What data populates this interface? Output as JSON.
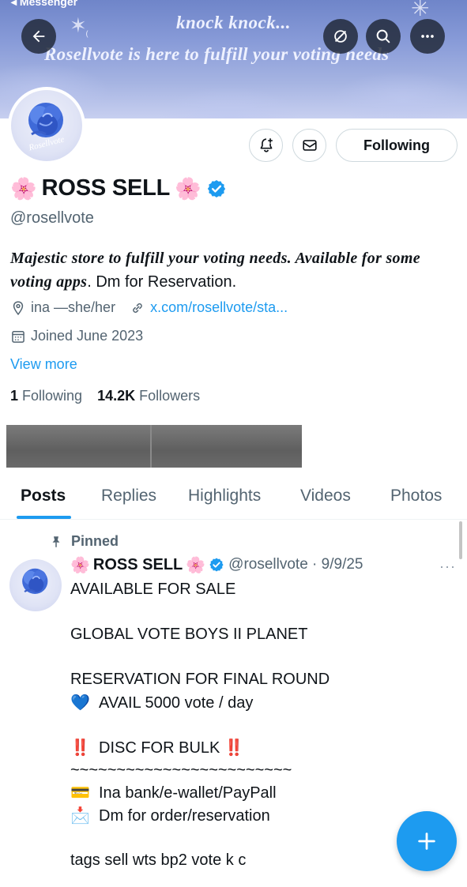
{
  "status": {
    "back_label": "◂ Messenger"
  },
  "banner": {
    "line1": "knock knock...",
    "line2": "Rosellvote is here to fulfill your voting needs"
  },
  "header_icons": {
    "back": "arrow-left-icon",
    "grok": "grok-icon",
    "search": "search-icon",
    "more": "more-horizontal-icon"
  },
  "avatar": {
    "text": "Rosellvote"
  },
  "actions": {
    "notify_icon": "bell-plus-icon",
    "message_icon": "envelope-icon",
    "following_label": "Following"
  },
  "profile": {
    "name_prefix_emoji": "🌸",
    "name": "ROSS SELL",
    "name_suffix_emoji": "🌸",
    "handle": "@rosellvote",
    "bio_fancy": "Majestic store to fulfill your voting needs. Available for some voting apps",
    "bio_plain": ". Dm for Reservation.",
    "location": "ina —she/her",
    "link": "x.com/rosellvote/sta...",
    "joined": "Joined June 2023",
    "view_more": "View more",
    "following_count": "1",
    "following_label": "Following",
    "followers_count": "14.2K",
    "followers_label": "Followers"
  },
  "tabs": [
    {
      "label": "Posts",
      "active": true
    },
    {
      "label": "Replies",
      "active": false
    },
    {
      "label": "Highlights",
      "active": false
    },
    {
      "label": "Videos",
      "active": false
    },
    {
      "label": "Photos",
      "active": false
    }
  ],
  "post": {
    "pinned_label": "Pinned",
    "author_emoji": "🌸",
    "author": "ROSS SELL",
    "handle_date": "@rosellvote · 9/9/25",
    "more_label": "···",
    "lines": [
      {
        "emoji": "",
        "text": "AVAILABLE FOR SALE"
      },
      {
        "emoji": "",
        "text": ""
      },
      {
        "emoji": "",
        "text": "GLOBAL VOTE BOYS II PLANET"
      },
      {
        "emoji": "",
        "text": ""
      },
      {
        "emoji": "",
        "text": "RESERVATION FOR FINAL ROUND"
      },
      {
        "emoji": "💙",
        "text": "AVAIL 5000 vote / day"
      },
      {
        "emoji": "",
        "text": ""
      },
      {
        "emoji": "‼️",
        "text": "DISC FOR BULK ‼️"
      },
      {
        "emoji": "",
        "text": " ~~~~~~~~~~~~~~~~~~~~~~~~"
      },
      {
        "emoji": "💳",
        "text": "Ina bank/e-wallet/PayPall"
      },
      {
        "emoji": "📩",
        "text": "Dm for order/reservation"
      },
      {
        "emoji": "",
        "text": ""
      },
      {
        "emoji": "",
        "text": "tags sell wts bp2 vote k c"
      }
    ]
  },
  "fab": {
    "icon": "plus-icon"
  },
  "colors": {
    "accent": "#1d9bf0",
    "text": "#0f1419",
    "muted": "#536471",
    "border": "#cfd9de"
  }
}
